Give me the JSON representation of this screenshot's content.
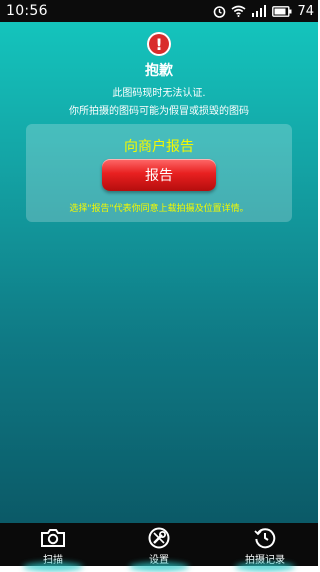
{
  "status_bar": {
    "time": "10:56",
    "battery_percent": "74",
    "icons": [
      "alarm-icon",
      "wifi-icon",
      "signal-icon",
      "battery-icon"
    ]
  },
  "alert": {
    "icon": "exclamation-icon",
    "title": "抱歉",
    "line1": "此图码现时无法认证.",
    "line2": "你所拍摄的图码可能为假冒或损毁的图码"
  },
  "report_panel": {
    "title": "向商户报告",
    "button_label": "报告",
    "note": "选择\"报告\"代表你同意上载拍摄及位置详情。"
  },
  "bottom_nav": [
    {
      "label": "扫描",
      "icon": "camera-icon"
    },
    {
      "label": "设置",
      "icon": "settings-icon"
    },
    {
      "label": "拍摄记录",
      "icon": "history-icon"
    }
  ],
  "colors": {
    "accent_yellow": "#f3f800",
    "button_red": "#e82020",
    "background_top": "#14c9c0",
    "background_bottom": "#0a5260"
  }
}
